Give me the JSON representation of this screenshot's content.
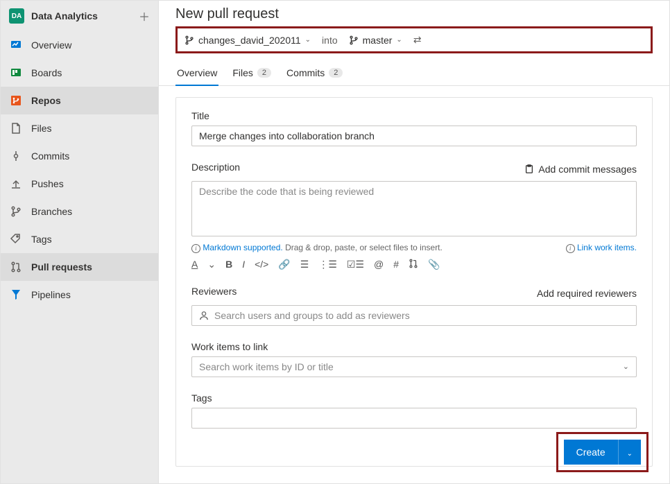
{
  "project": {
    "abbrev": "DA",
    "name": "Data Analytics"
  },
  "sidebar": [
    {
      "label": "Overview",
      "icon": "overview"
    },
    {
      "label": "Boards",
      "icon": "boards"
    },
    {
      "label": "Repos",
      "icon": "repos",
      "active": true
    },
    {
      "label": "Files",
      "icon": "files",
      "sub": true
    },
    {
      "label": "Commits",
      "icon": "commits",
      "sub": true
    },
    {
      "label": "Pushes",
      "icon": "pushes",
      "sub": true
    },
    {
      "label": "Branches",
      "icon": "branches",
      "sub": true
    },
    {
      "label": "Tags",
      "icon": "tags",
      "sub": true
    },
    {
      "label": "Pull requests",
      "icon": "pullrequests",
      "sub": true,
      "active": true
    },
    {
      "label": "Pipelines",
      "icon": "pipelines"
    }
  ],
  "page": {
    "title": "New pull request"
  },
  "branches": {
    "source": "changes_david_202011",
    "into": "into",
    "target": "master"
  },
  "tabs": [
    {
      "label": "Overview",
      "active": true
    },
    {
      "label": "Files",
      "count": "2"
    },
    {
      "label": "Commits",
      "count": "2"
    }
  ],
  "form": {
    "titleLabel": "Title",
    "titleValue": "Merge changes into collaboration branch",
    "descLabel": "Description",
    "addCommitMsg": "Add commit messages",
    "descPlaceholder": "Describe the code that is being reviewed",
    "markdownHint": "Markdown supported.",
    "dragHint": " Drag & drop, paste, or select files to insert.",
    "linkWorkItems": "Link work items.",
    "reviewersLabel": "Reviewers",
    "addRequired": "Add required reviewers",
    "reviewersPlaceholder": "Search users and groups to add as reviewers",
    "workItemsLabel": "Work items to link",
    "workItemsPlaceholder": "Search work items by ID or title",
    "tagsLabel": "Tags",
    "createLabel": "Create"
  }
}
